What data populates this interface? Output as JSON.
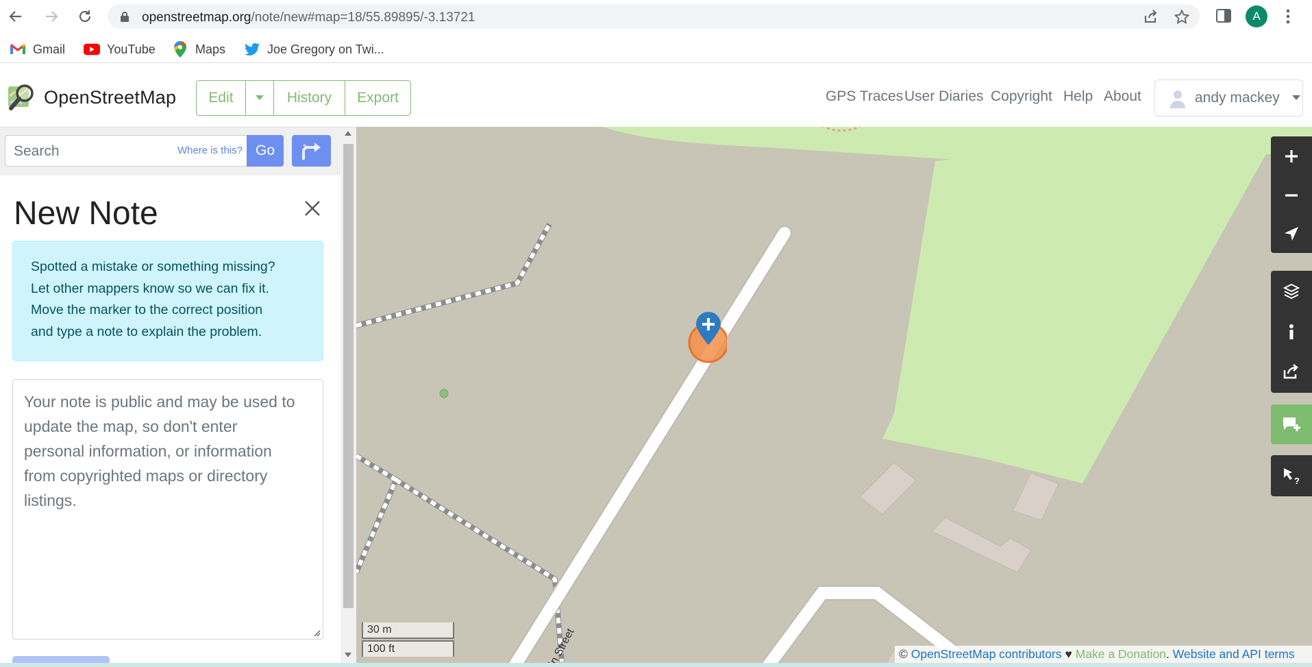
{
  "browser": {
    "url_host": "openstreetmap.org",
    "url_path": "/note/new#map=18/55.89895/-3.13721",
    "profile_initial": "A",
    "bookmarks": [
      {
        "label": "Gmail",
        "icon": "gmail-icon"
      },
      {
        "label": "YouTube",
        "icon": "youtube-icon"
      },
      {
        "label": "Maps",
        "icon": "maps-icon"
      },
      {
        "label": "Joe Gregory on Twi...",
        "icon": "twitter-icon"
      }
    ]
  },
  "header": {
    "logo_text": "OpenStreetMap",
    "edit_label": "Edit",
    "history_label": "History",
    "export_label": "Export",
    "nav": [
      "GPS Traces",
      "User Diaries",
      "Copyright",
      "Help",
      "About"
    ],
    "user_name": "andy mackey"
  },
  "search": {
    "placeholder": "Search",
    "where_is_this": "Where is this?",
    "go_label": "Go"
  },
  "note": {
    "title": "New Note",
    "info_lines": [
      "Spotted a mistake or something missing?",
      "Let other mappers know so we can fix it.",
      "Move the marker to the correct position",
      "and type a note to explain the problem."
    ],
    "textarea_placeholder_lines": [
      "Your note is public and may be used to",
      "update the map, so don't enter",
      "personal information, or information",
      "from copyrighted maps or directory",
      "listings."
    ]
  },
  "map": {
    "street_label": "in Street",
    "scale_metric": "30 m",
    "scale_imperial": "100 ft",
    "attribution": {
      "prefix": "© ",
      "contributors": "OpenStreetMap contributors",
      "heart": " ♥ ",
      "donate": "Make a Donation",
      "sep": ". ",
      "terms": "Website and API terms"
    },
    "controls": [
      "zoom-in-icon",
      "zoom-out-icon",
      "locate-icon",
      "layers-icon",
      "info-icon",
      "share-icon",
      "add-note-icon",
      "query-icon"
    ]
  },
  "colors": {
    "osm_green": "#7ebc6f",
    "go_blue": "#6d8ff0",
    "map_land": "#c8c5b7",
    "map_park": "#cdebb0",
    "alert_bg": "#cff4fc",
    "add_note_active": "#7ebc6f"
  }
}
